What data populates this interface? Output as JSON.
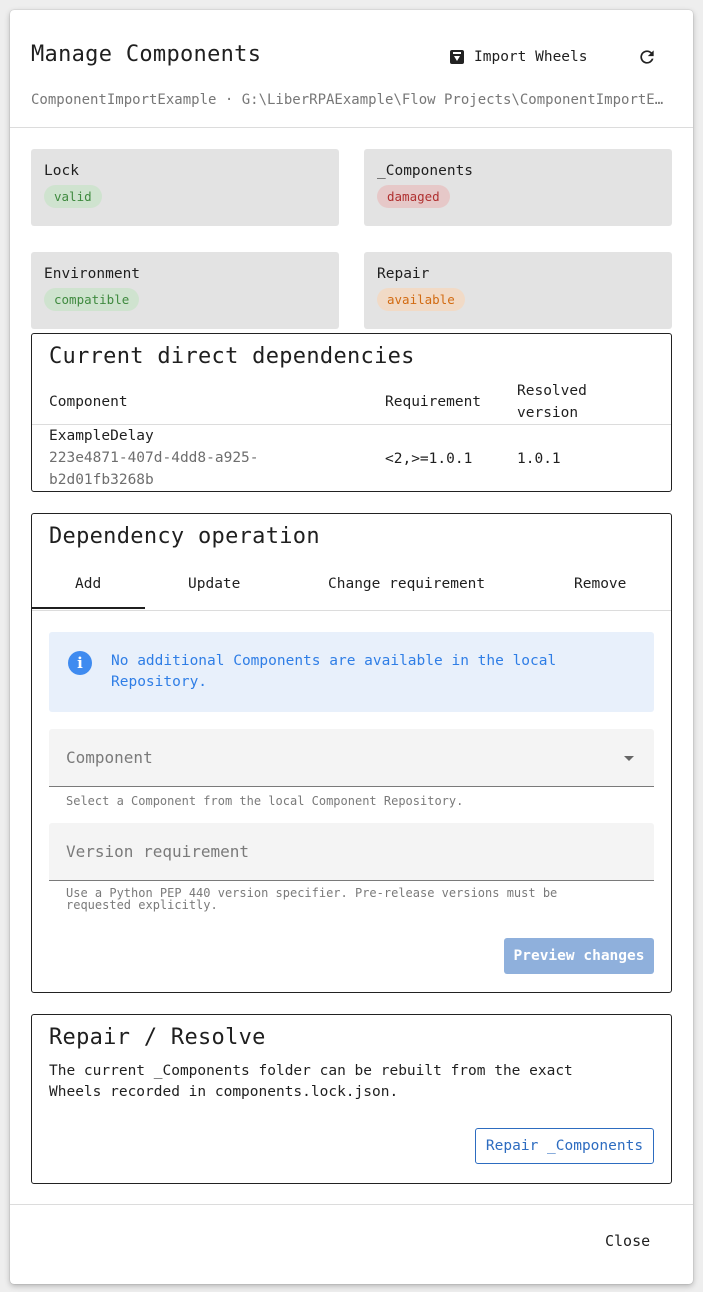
{
  "dialog": {
    "title": "Manage Components",
    "import_label": "Import Wheels",
    "subtitle": "ComponentImportExample · G:\\LiberRPAExample\\Flow Projects\\ComponentImportExample",
    "close_label": "Close"
  },
  "status": {
    "lock": {
      "label": "Lock",
      "value": "valid",
      "color": "#3f8a3f"
    },
    "components": {
      "label": "_Components",
      "value": "damaged",
      "color": "#b03030"
    },
    "environment": {
      "label": "Environment",
      "value": "compatible",
      "color": "#3f8a3f"
    },
    "repair": {
      "label": "Repair",
      "value": "available",
      "color": "#d26b12"
    }
  },
  "dependencies": {
    "title": "Current direct dependencies",
    "columns": {
      "component": "Component",
      "requirement": "Requirement",
      "resolved_line1": "Resolved",
      "resolved_line2": "version"
    },
    "rows": [
      {
        "name": "ExampleDelay",
        "id_line1": "223e4871-407d-4dd8-a925-",
        "id_line2": "b2d01fb3268b",
        "requirement": "<2,>=1.0.1",
        "resolved": "1.0.1"
      }
    ]
  },
  "operation": {
    "title": "Dependency operation",
    "tabs": [
      "Add",
      "Update",
      "Change requirement",
      "Remove"
    ],
    "active_tab": "Add",
    "info_message": "No additional Components are available in the local Repository.",
    "component_placeholder": "Component",
    "component_helper": "Select a Component from the local Component Repository.",
    "version_placeholder": "Version requirement",
    "version_helper_line1": "Use a Python PEP 440 version specifier. Pre-release versions must be",
    "version_helper_line2": "requested explicitly.",
    "preview_label": "Preview changes"
  },
  "repair": {
    "title": "Repair / Resolve",
    "text_line1": "The current _Components folder can be rebuilt from the exact",
    "text_line2": "Wheels recorded in components.lock.json.",
    "button_label": "Repair _Components"
  },
  "colors": {
    "accent": "#2d6cc0",
    "info_bg": "#e8f0fb",
    "info_text": "#2f7ee6"
  }
}
